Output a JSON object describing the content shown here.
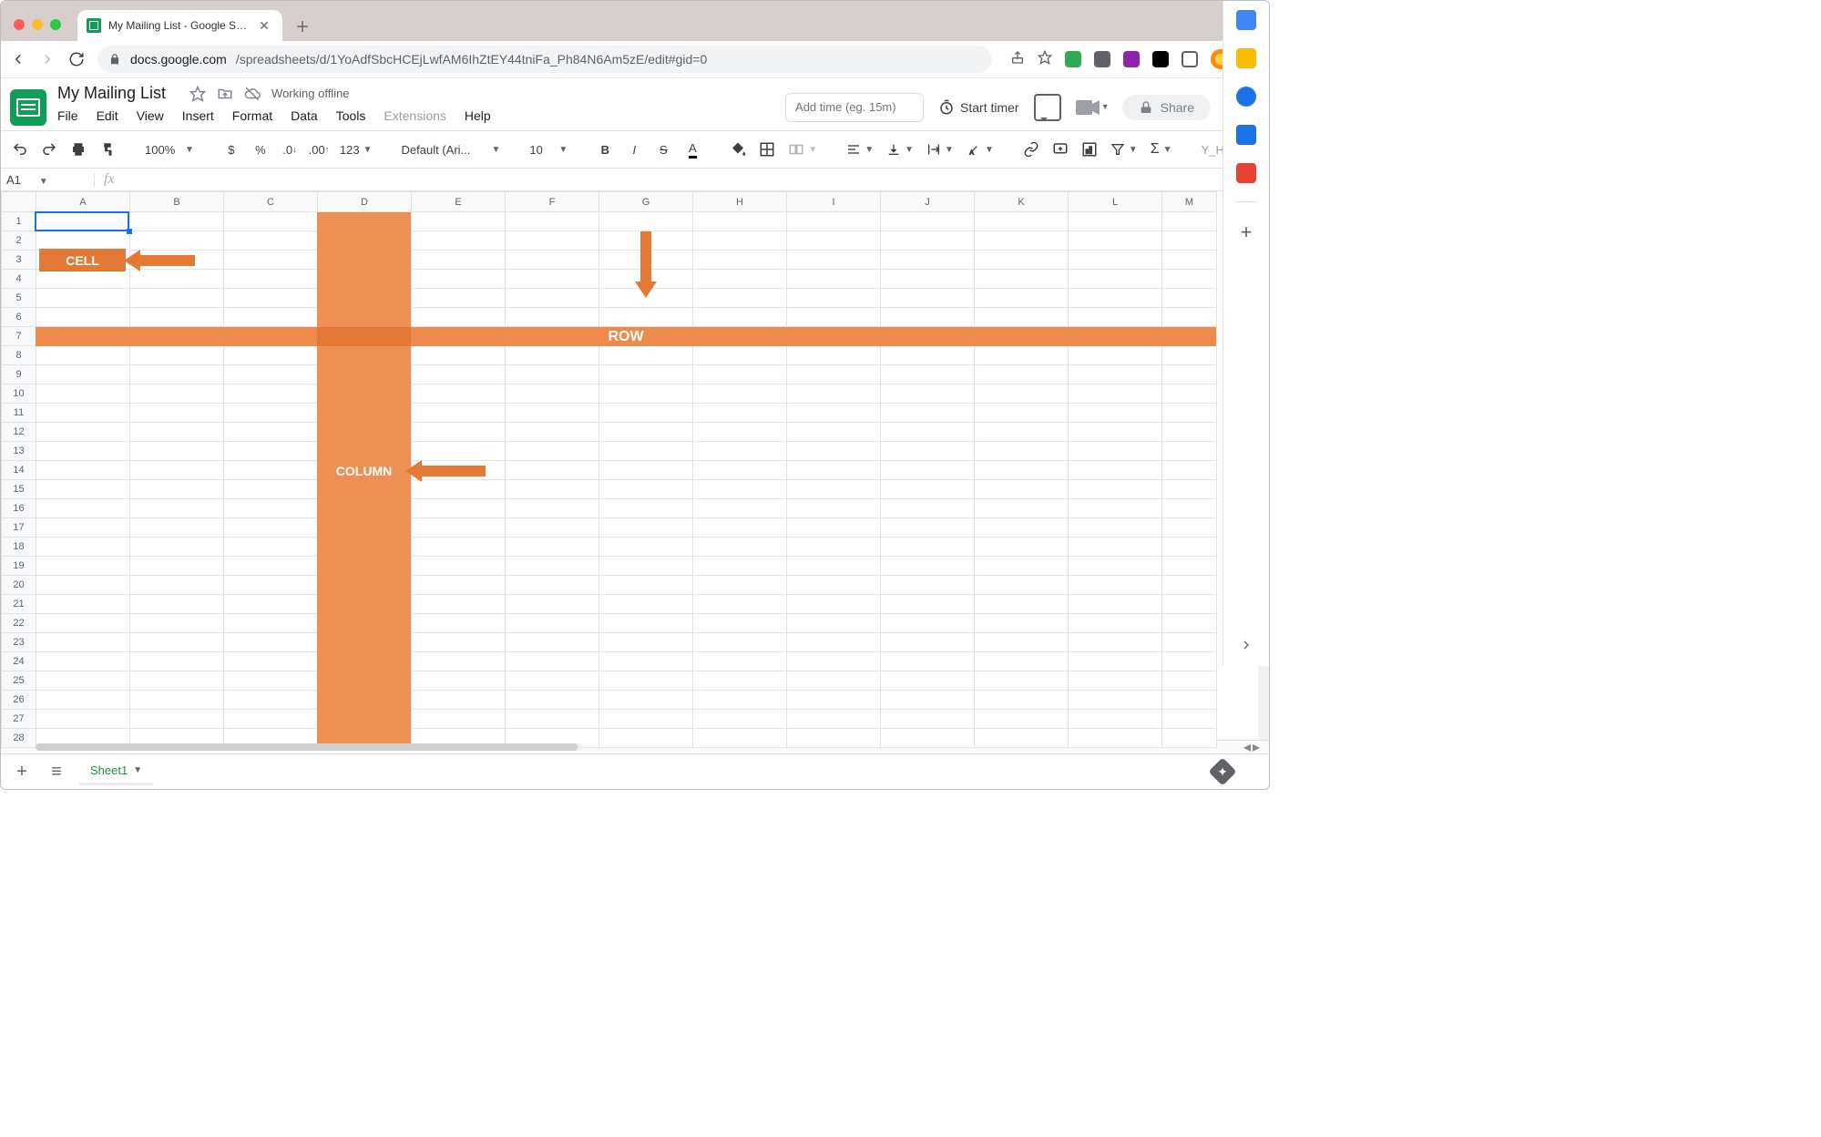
{
  "browser": {
    "tab_title": "My Mailing List - Google Sheet",
    "url_host": "docs.google.com",
    "url_path": "/spreadsheets/d/1YoAdfSbcHCEjLwfAM6IhZtEY44tniFa_Ph84N6Am5zE/edit#gid=0"
  },
  "doc": {
    "title": "My Mailing List",
    "offline": "Working offline",
    "timer_placeholder": "Add time (eg. 15m)",
    "start_timer": "Start timer",
    "share": "Share"
  },
  "menu": [
    "File",
    "Edit",
    "View",
    "Insert",
    "Format",
    "Data",
    "Tools",
    "Extensions",
    "Help"
  ],
  "toolbar": {
    "zoom": "100%",
    "num_fmt": "123",
    "font": "Default (Ari...",
    "font_size": "10",
    "more": "Y_H"
  },
  "namebox": {
    "ref": "A1"
  },
  "columns": [
    "A",
    "B",
    "C",
    "D",
    "E",
    "F",
    "G",
    "H",
    "I",
    "J",
    "K",
    "L",
    "M"
  ],
  "rows": 28,
  "annotations": {
    "cell_label": "CELL",
    "row_label": "ROW",
    "column_label": "COLUMN"
  },
  "sheet_tabs": {
    "active": "Sheet1"
  }
}
